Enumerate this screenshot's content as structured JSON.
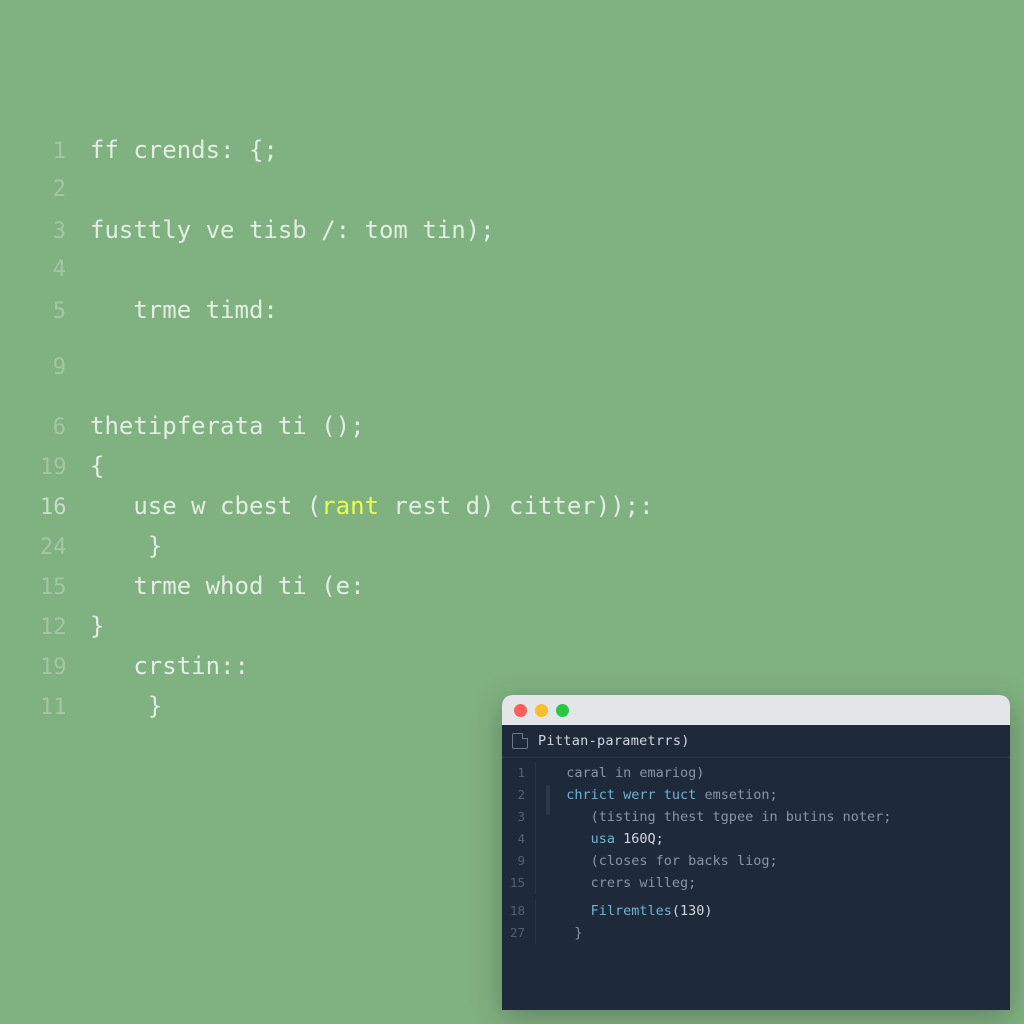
{
  "background_editor": {
    "lines": [
      {
        "num": "1",
        "indent": "",
        "segments": [
          {
            "t": "ff crends: {;",
            "c": ""
          }
        ]
      },
      {
        "num": "2",
        "indent": "",
        "segments": []
      },
      {
        "num": "3",
        "indent": "",
        "segments": [
          {
            "t": "fusttly ve tisb /: tom tin);",
            "c": ""
          }
        ]
      },
      {
        "num": "4",
        "indent": "",
        "segments": []
      },
      {
        "num": "5",
        "indent": "   ",
        "segments": [
          {
            "t": "trme timd:",
            "c": ""
          }
        ]
      },
      {
        "num": "9",
        "indent": "",
        "segments": []
      },
      {
        "num": "6",
        "indent": "",
        "segments": [
          {
            "t": "thetipferata ti ();",
            "c": ""
          }
        ]
      },
      {
        "num": "19",
        "indent": "",
        "segments": [
          {
            "t": "{",
            "c": ""
          }
        ]
      },
      {
        "num": "16",
        "indent": "   ",
        "segments": [
          {
            "t": "use w cbest (",
            "c": ""
          },
          {
            "t": "rant",
            "c": "hl"
          },
          {
            "t": " rest d) citter));:",
            "c": ""
          }
        ],
        "bright": true
      },
      {
        "num": "24",
        "indent": "    ",
        "segments": [
          {
            "t": "}",
            "c": ""
          }
        ]
      },
      {
        "num": "15",
        "indent": "   ",
        "segments": [
          {
            "t": "trme whod ti (e:",
            "c": ""
          }
        ]
      },
      {
        "num": "12",
        "indent": "",
        "segments": [
          {
            "t": "}",
            "c": ""
          }
        ]
      },
      {
        "num": "19",
        "indent": "   ",
        "segments": [
          {
            "t": "crstin::",
            "c": ""
          }
        ]
      },
      {
        "num": "11",
        "indent": "    ",
        "segments": [
          {
            "t": "}",
            "c": ""
          }
        ]
      }
    ]
  },
  "window": {
    "title": "Pittan-parametrrs)",
    "lines": [
      {
        "num": "1",
        "indent": "  ",
        "segments": [
          {
            "t": "caral in emariog)",
            "c": "muted"
          }
        ]
      },
      {
        "num": "2",
        "indent": "  ",
        "segments": [
          {
            "t": "chrict werr tuct ",
            "c": "kw"
          },
          {
            "t": "emsetion;",
            "c": "muted"
          }
        ]
      },
      {
        "num": "3",
        "indent": "     ",
        "segments": [
          {
            "t": "(tisting thest tgpee in butins noter;",
            "c": "muted"
          }
        ]
      },
      {
        "num": "4",
        "indent": "     ",
        "segments": [
          {
            "t": "usa ",
            "c": "kw"
          },
          {
            "t": "160Q;",
            "c": "num"
          }
        ]
      },
      {
        "num": "9",
        "indent": "     ",
        "segments": [
          {
            "t": "(closes for backs liog;",
            "c": "muted"
          }
        ]
      },
      {
        "num": "15",
        "indent": "     ",
        "segments": [
          {
            "t": "crers willeg;",
            "c": "muted"
          }
        ]
      },
      {
        "num": "18",
        "indent": "     ",
        "segments": [
          {
            "t": "Filremtles",
            "c": "fn"
          },
          {
            "t": "(130)",
            "c": "num"
          }
        ]
      },
      {
        "num": "27",
        "indent": "   ",
        "segments": [
          {
            "t": "}",
            "c": "muted"
          }
        ]
      }
    ]
  }
}
